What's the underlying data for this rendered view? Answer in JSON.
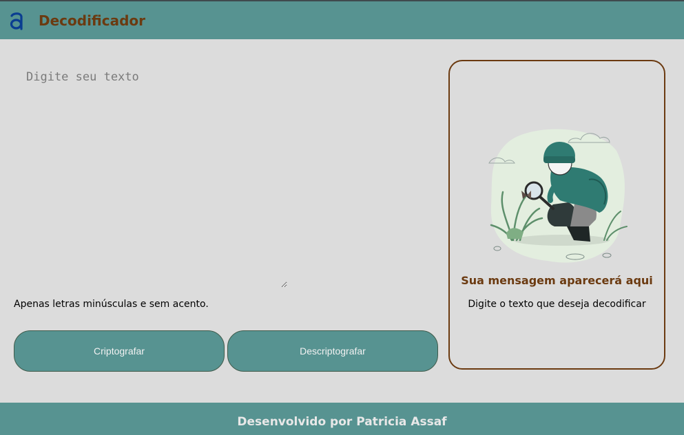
{
  "header": {
    "logo_icon": "alura-a-logo-icon",
    "title": "Decodificador"
  },
  "input": {
    "placeholder": "Digite seu texto",
    "value": "",
    "hint": "Apenas letras minúsculas e sem acento."
  },
  "buttons": {
    "encrypt_label": "Criptografar",
    "decrypt_label": "Descriptografar"
  },
  "output": {
    "illustration": "person-with-magnifying-glass-illustration",
    "title": "Sua mensagem aparecerá aqui",
    "subtitle": "Digite o texto que deseja decodificar"
  },
  "footer": {
    "text": "Desenvolvido por Patricia Assaf"
  },
  "colors": {
    "primary": "#579391",
    "accent_brown": "#6b3a10",
    "background": "#dcdcdc"
  }
}
